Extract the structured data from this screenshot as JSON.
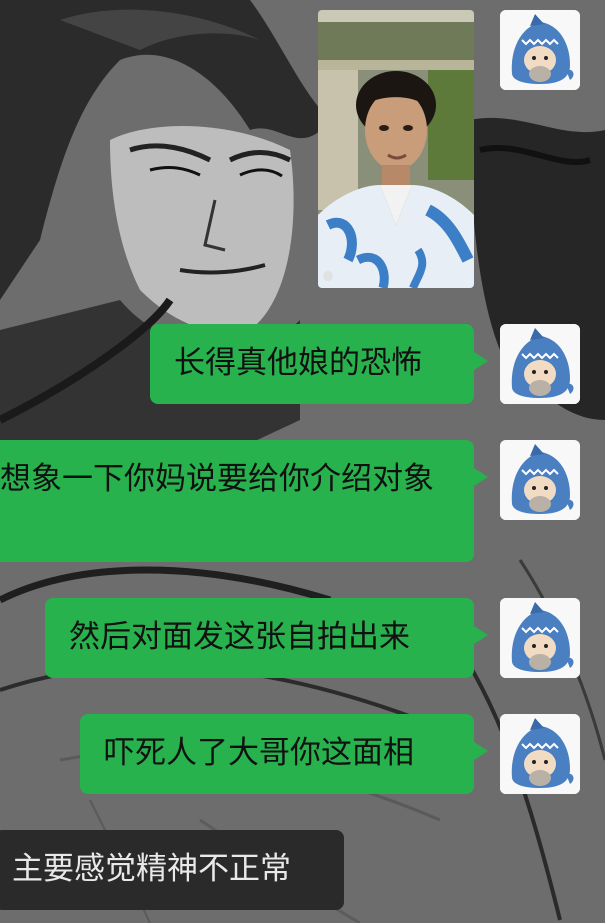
{
  "chat": {
    "messages": [
      {
        "side": "right",
        "type": "image"
      },
      {
        "side": "right",
        "type": "text",
        "text": "长得真他娘的恐怖"
      },
      {
        "side": "right",
        "type": "text",
        "text": "想象一下你妈说要给你介绍对象"
      },
      {
        "side": "right",
        "type": "text",
        "text": "然后对面发这张自拍出来"
      },
      {
        "side": "right",
        "type": "text",
        "text": "吓死人了大哥你这面相"
      },
      {
        "side": "left",
        "type": "text",
        "text": "主要感觉精神不正常"
      }
    ]
  },
  "colors": {
    "outgoing_bubble": "#27b24e",
    "incoming_bubble": "#2a2a2a",
    "background": "#6e6e6e"
  },
  "icons": {
    "avatar": "shark-costume-avatar-icon"
  }
}
